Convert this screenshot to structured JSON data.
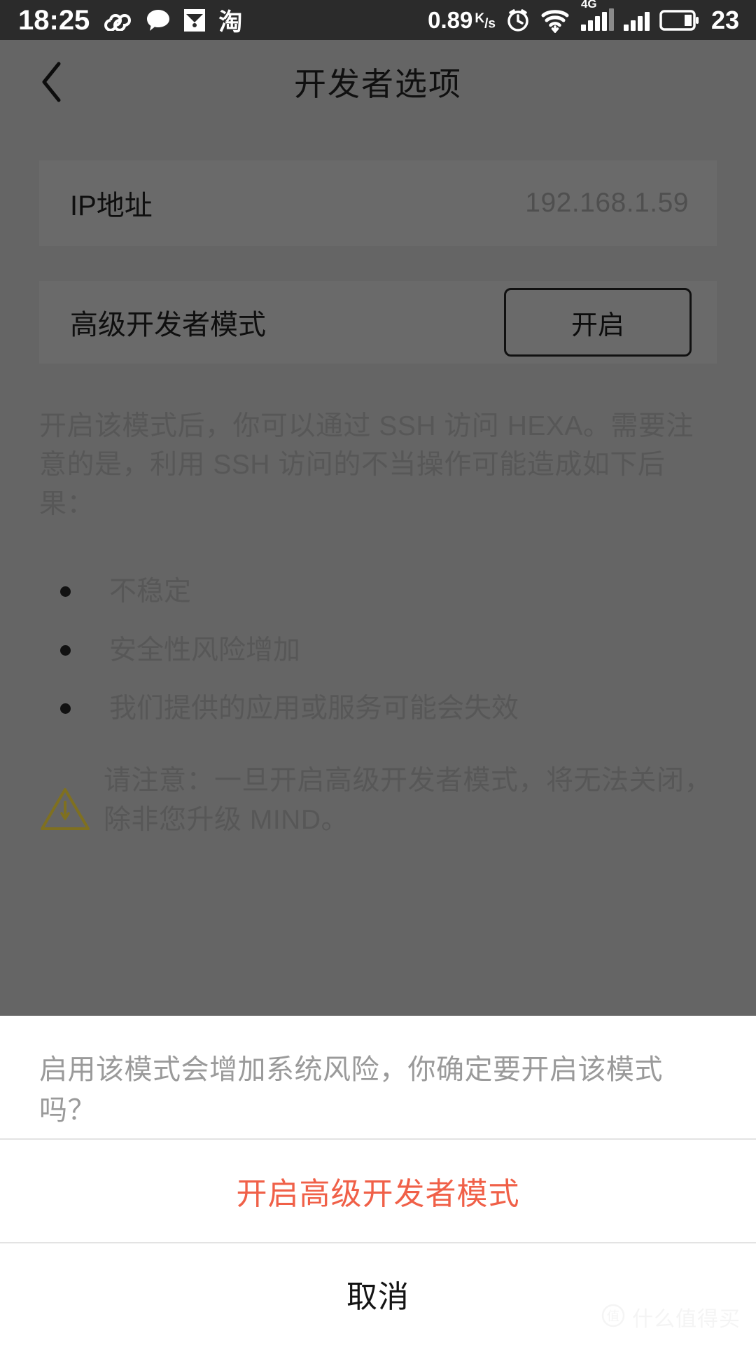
{
  "status_bar": {
    "time": "18:25",
    "icons_left": [
      "infinity-icon",
      "chat-bubble-icon",
      "image-icon",
      "taobao-icon"
    ],
    "taobao_label": "淘",
    "network_speed": "0.89",
    "network_speed_unit_top": "K",
    "network_speed_unit_bottom": "s",
    "icons_right": [
      "alarm-clock-icon",
      "wifi-download-icon",
      "signal-4g-icon",
      "signal-icon",
      "battery-icon"
    ],
    "signal_4g_label": "4G",
    "battery_percent": "23",
    "background_color": "#2b2b2b"
  },
  "header": {
    "back_icon": "chevron-left-icon",
    "title": "开发者选项"
  },
  "settings": {
    "ip_row": {
      "label": "IP地址",
      "value": "192.168.1.59"
    },
    "mode_row": {
      "label": "高级开发者模式",
      "button_label": "开启"
    }
  },
  "description": "开启该模式后，你可以通过 SSH 访问 HEXA。需要注意的是，利用 SSH 访问的不当操作可能造成如下后果：",
  "consequences": [
    "不稳定",
    "安全性风险增加",
    "我们提供的应用或服务可能会失效"
  ],
  "note": {
    "icon": "warning-triangle-icon",
    "icon_color": "#c9b233",
    "text": "请注意：一旦开启高级开发者模式，将无法关闭，除非您升级 MIND。"
  },
  "dialog": {
    "message": "启用该模式会增加系统风险，你确定要开启该模式吗？",
    "confirm_label": "开启高级开发者模式",
    "confirm_color": "#f06048",
    "cancel_label": "取消"
  },
  "watermark": {
    "logo_label": "值",
    "text": "什么值得买"
  }
}
